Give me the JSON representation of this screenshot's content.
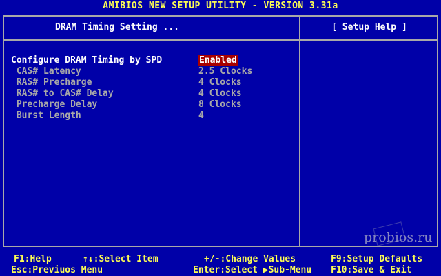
{
  "header": {
    "title": "AMIBIOS NEW SETUP UTILITY - VERSION 3.31a"
  },
  "panel": {
    "title": "DRAM Timing Setting ...",
    "help_title": "[  Setup Help  ]"
  },
  "settings": [
    {
      "label": "Configure DRAM Timing by SPD",
      "value": "Enabled"
    },
    {
      "label": " CAS# Latency",
      "value": "2.5 Clocks"
    },
    {
      "label": " RAS# Precharge",
      "value": "4 Clocks"
    },
    {
      "label": " RAS# to CAS# Delay",
      "value": "4 Clocks"
    },
    {
      "label": " Precharge Delay",
      "value": "8 Clocks"
    },
    {
      "label": " Burst Length",
      "value": "4"
    }
  ],
  "footer": {
    "f1": "F1:Help",
    "esc": "Esc:Previuos Menu",
    "select_item": "↑↓:Select Item",
    "change_values": "+/-:Change Values",
    "enter_select": "Enter:Select ▶Sub-Menu",
    "f9": "F9:Setup Defaults",
    "f10": "F10:Save & Exit"
  },
  "watermark": {
    "text": "probios.ru"
  },
  "colors": {
    "background": "#0000a8",
    "title": "#fcfc54",
    "highlight": "#fcfcfc",
    "dim": "#a8a8a8",
    "selected_bg": "#a80000"
  }
}
